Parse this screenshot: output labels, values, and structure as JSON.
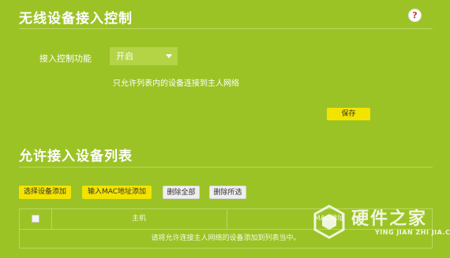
{
  "section1": {
    "title": "无线设备接入控制",
    "help_icon": "?",
    "field_label": "接入控制功能",
    "field_value": "开启",
    "hint": "只允许列表内的设备连接到主人网络",
    "save_label": "保存"
  },
  "section2": {
    "title": "允许接入设备列表",
    "toolbar": {
      "select_add": "选择设备添加",
      "mac_add": "输入MAC地址添加",
      "delete_all": "删除全部",
      "delete_selected": "删除所选"
    },
    "table": {
      "headers": {
        "host": "主机",
        "mac": "MAC地址"
      },
      "empty_message": "请将允许连接主人网络的设备添加到列表当中。"
    }
  },
  "watermark": {
    "name": "硬件之家",
    "sub": "YING JIAN ZHI JIA.COM"
  },
  "colors": {
    "background": "#9cc326",
    "button_yellow": "#f3e400",
    "help_red": "#d23a2a"
  }
}
